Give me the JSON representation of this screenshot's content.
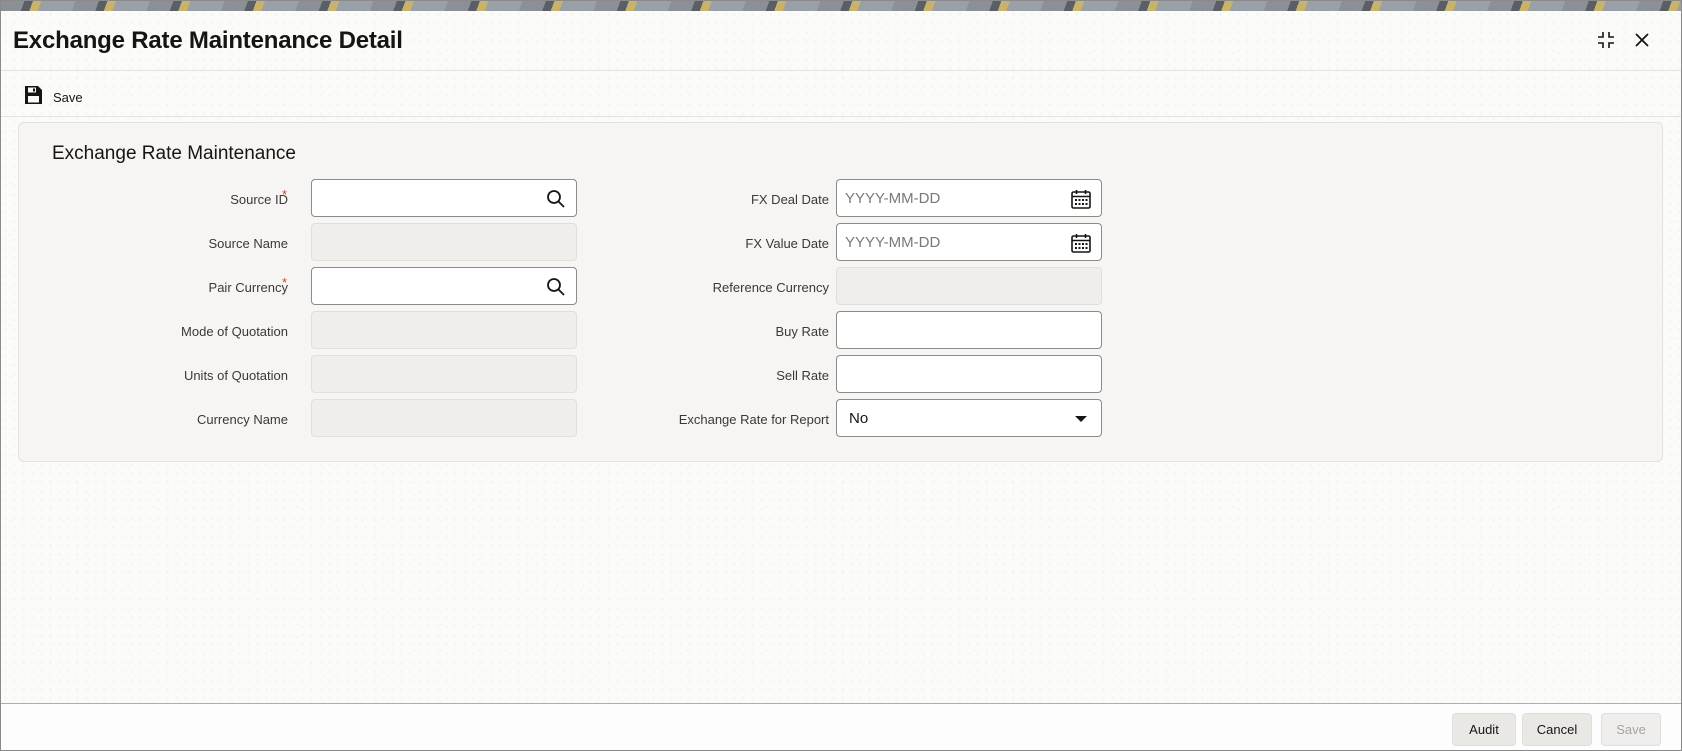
{
  "header": {
    "title": "Exchange Rate Maintenance Detail"
  },
  "toolbar": {
    "save_label": "Save"
  },
  "section": {
    "title": "Exchange Rate Maintenance"
  },
  "left_fields": {
    "source_id": {
      "label": "Source ID",
      "required": "*",
      "value": ""
    },
    "source_name": {
      "label": "Source Name",
      "value": ""
    },
    "pair_currency": {
      "label": "Pair Currency",
      "required": "*",
      "value": ""
    },
    "mode_of_quotation": {
      "label": "Mode of Quotation",
      "value": ""
    },
    "units_of_quotation": {
      "label": "Units of Quotation",
      "value": ""
    },
    "currency_name": {
      "label": "Currency Name",
      "value": ""
    }
  },
  "right_fields": {
    "fx_deal_date": {
      "label": "FX Deal Date",
      "placeholder": "YYYY-MM-DD"
    },
    "fx_value_date": {
      "label": "FX Value Date",
      "placeholder": "YYYY-MM-DD"
    },
    "reference_currency": {
      "label": "Reference Currency",
      "value": ""
    },
    "buy_rate": {
      "label": "Buy Rate",
      "value": ""
    },
    "sell_rate": {
      "label": "Sell Rate",
      "value": ""
    },
    "exchange_rate_for_report": {
      "label": "Exchange Rate for Report",
      "value": "No",
      "options": [
        "No"
      ]
    }
  },
  "footer": {
    "audit_label": "Audit",
    "cancel_label": "Cancel",
    "save_label": "Save"
  },
  "colors": {
    "required": "#c74634",
    "panel_bg": "#f6f5f3",
    "readonly_bg": "#efeeeb"
  },
  "icons": [
    "save-icon",
    "maximize-icon",
    "close-icon",
    "search-icon",
    "calendar-icon",
    "chevron-down-icon"
  ]
}
